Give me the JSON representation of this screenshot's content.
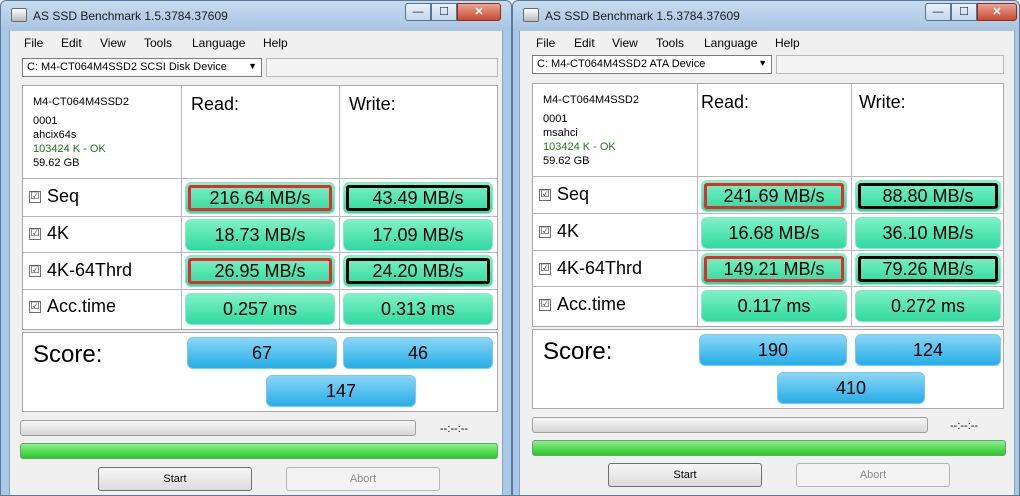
{
  "windows": [
    {
      "title": "AS SSD Benchmark 1.5.3784.37609",
      "controls": {
        "min": "—",
        "max": "☐",
        "close": "✕"
      },
      "menu": [
        "File",
        "Edit",
        "View",
        "Tools",
        "Language",
        "Help"
      ],
      "drive": "C:  M4-CT064M4SSD2 SCSI Disk Device",
      "info": [
        "M4-CT064M4SSD2",
        "0001",
        "ahcix64s",
        "103424 K - OK",
        "59.62 GB"
      ],
      "headers": {
        "read": "Read:",
        "write": "Write:"
      },
      "rows": [
        {
          "label": "Seq",
          "checked": "☑",
          "read": "216.64 MB/s",
          "write": "43.49 MB/s",
          "read_box": "red",
          "write_box": "black"
        },
        {
          "label": "4K",
          "checked": "☑",
          "read": "18.73 MB/s",
          "write": "17.09 MB/s",
          "read_box": "",
          "write_box": ""
        },
        {
          "label": "4K-64Thrd",
          "checked": "☑",
          "read": "26.95 MB/s",
          "write": "24.20 MB/s",
          "read_box": "red",
          "write_box": "black"
        },
        {
          "label": "Acc.time",
          "checked": "☑",
          "read": "0.257 ms",
          "write": "0.313 ms",
          "read_box": "",
          "write_box": ""
        }
      ],
      "score": {
        "label": "Score:",
        "read": "67",
        "write": "46",
        "total": "147"
      },
      "time": "--:--:--",
      "buttons": {
        "start": "Start",
        "abort": "Abort"
      }
    },
    {
      "title": "AS SSD Benchmark 1.5.3784.37609",
      "controls": {
        "min": "—",
        "max": "☐",
        "close": "✕"
      },
      "menu": [
        "File",
        "Edit",
        "View",
        "Tools",
        "Language",
        "Help"
      ],
      "drive": "C:  M4-CT064M4SSD2 ATA Device",
      "info": [
        "M4-CT064M4SSD2",
        "0001",
        "msahci",
        "103424 K - OK",
        "59.62 GB"
      ],
      "headers": {
        "read": "Read:",
        "write": "Write:"
      },
      "rows": [
        {
          "label": "Seq",
          "checked": "☑",
          "read": "241.69 MB/s",
          "write": "88.80 MB/s",
          "read_box": "red",
          "write_box": "black"
        },
        {
          "label": "4K",
          "checked": "☑",
          "read": "16.68 MB/s",
          "write": "36.10 MB/s",
          "read_box": "",
          "write_box": ""
        },
        {
          "label": "4K-64Thrd",
          "checked": "☑",
          "read": "149.21 MB/s",
          "write": "79.26 MB/s",
          "read_box": "red",
          "write_box": "black"
        },
        {
          "label": "Acc.time",
          "checked": "☑",
          "read": "0.117 ms",
          "write": "0.272 ms",
          "read_box": "",
          "write_box": ""
        }
      ],
      "score": {
        "label": "Score:",
        "read": "190",
        "write": "124",
        "total": "410"
      },
      "time": "--:--:--",
      "buttons": {
        "start": "Start",
        "abort": "Abort"
      }
    }
  ]
}
